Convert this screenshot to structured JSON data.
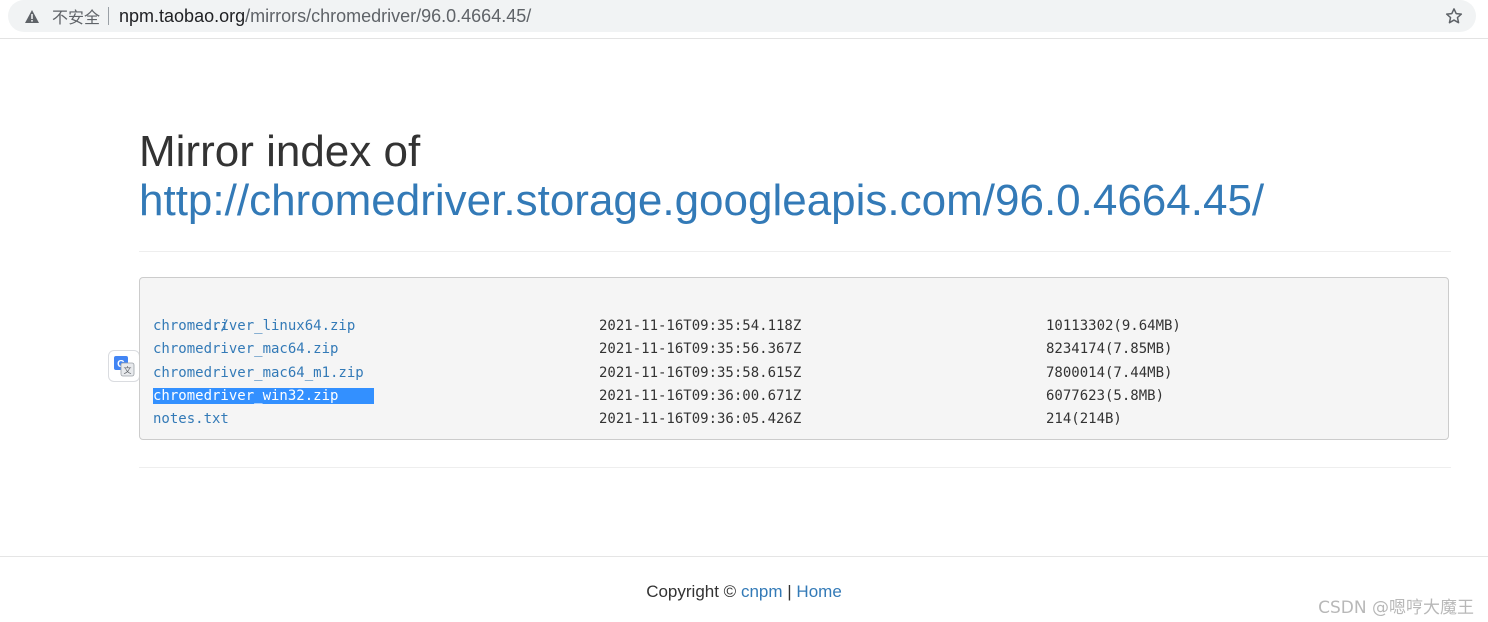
{
  "browser": {
    "security_label": "不安全",
    "url_host": "npm.taobao.org",
    "url_path": "/mirrors/chromedriver/96.0.4664.45/"
  },
  "page": {
    "title_prefix": "Mirror index of",
    "title_link": "http://chromedriver.storage.googleapis.com/96.0.4664.45/"
  },
  "listing": {
    "parent": "../",
    "files": [
      {
        "name": "chromedriver_linux64.zip",
        "date": "2021-11-16T09:35:54.118Z",
        "size": "10113302(9.64MB)"
      },
      {
        "name": "chromedriver_mac64.zip",
        "date": "2021-11-16T09:35:56.367Z",
        "size": "8234174(7.85MB)"
      },
      {
        "name": "chromedriver_mac64_m1.zip",
        "date": "2021-11-16T09:35:58.615Z",
        "size": "7800014(7.44MB)"
      },
      {
        "name": "chromedriver_win32.zip",
        "date": "2021-11-16T09:36:00.671Z",
        "size": "6077623(5.8MB)",
        "selected": true
      },
      {
        "name": "notes.txt",
        "date": "2021-11-16T09:36:05.426Z",
        "size": "214(214B)"
      }
    ]
  },
  "footer": {
    "copyright": "Copyright ©",
    "link1": "cnpm",
    "divider": "|",
    "link2": "Home"
  },
  "watermark": "CSDN @嗯哼大魔王",
  "icons": {
    "warning": "warning-icon",
    "star": "star-icon",
    "translate": "translate-icon"
  },
  "colors": {
    "link": "#337ab7",
    "selection": "#3390ff",
    "box_bg": "#f5f5f5"
  }
}
